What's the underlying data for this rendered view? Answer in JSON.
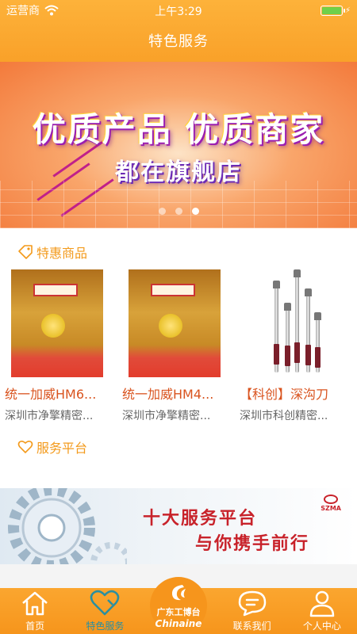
{
  "status": {
    "carrier": "运营商",
    "time": "上午3:29"
  },
  "header": {
    "title": "特色服务"
  },
  "banner": {
    "line1": "优质产品 优质商家",
    "line2": "都在旗舰店",
    "dots": 3,
    "active_dot": 2
  },
  "featured": {
    "title": "特惠商品",
    "products": [
      {
        "name": "统一加威HM6...",
        "shop": "深圳市净擎精密..."
      },
      {
        "name": "统一加威HM4...",
        "shop": "深圳市净擎精密..."
      },
      {
        "name": "【科创】深沟刀",
        "shop": "深圳市科创精密..."
      }
    ]
  },
  "services": {
    "title": "服务平台"
  },
  "service_banner": {
    "line1": "十大服务平台",
    "line2": "与你携手前行",
    "logo": "SZMA"
  },
  "tabbar": {
    "items": [
      {
        "label": "首页",
        "icon": "home-icon"
      },
      {
        "label": "特色服务",
        "icon": "heart-icon",
        "active": true
      },
      {
        "label": "联系我们",
        "icon": "chat-icon"
      },
      {
        "label": "个人中心",
        "icon": "user-icon"
      }
    ],
    "center_logo": {
      "cn": "广东工博台",
      "en": "Chinaine"
    }
  },
  "colors": {
    "primary": "#f6951c",
    "accent_text": "#d9531e",
    "active_tab": "#2b8fa0"
  }
}
